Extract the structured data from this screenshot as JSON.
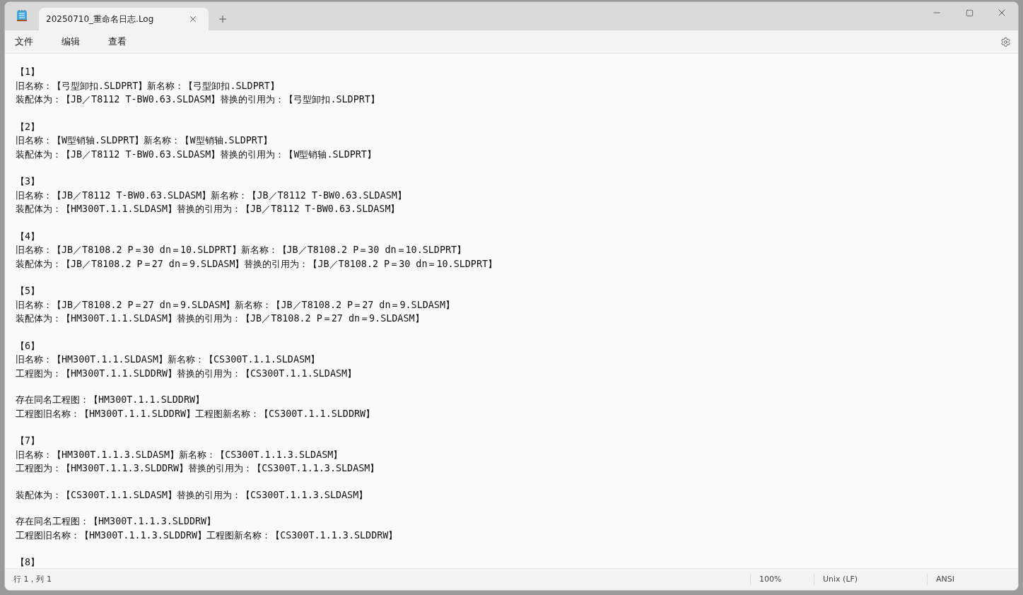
{
  "tab": {
    "title": "20250710_重命名日志.Log",
    "selected": true
  },
  "menu": [
    "文件",
    "编辑",
    "查看"
  ],
  "entries": [
    {
      "label": "【1】",
      "blocks": [
        [
          "旧名称：【弓型卸扣.SLDPRT】新名称：【弓型卸扣.SLDPRT】",
          "装配体为：【JB／T8112 T-BW0.63.SLDASM】替换的引用为：【弓型卸扣.SLDPRT】"
        ]
      ]
    },
    {
      "label": "【2】",
      "blocks": [
        [
          "旧名称：【W型销轴.SLDPRT】新名称：【W型销轴.SLDPRT】",
          "装配体为：【JB／T8112 T-BW0.63.SLDASM】替换的引用为：【W型销轴.SLDPRT】"
        ]
      ]
    },
    {
      "label": "【3】",
      "blocks": [
        [
          "旧名称：【JB／T8112 T-BW0.63.SLDASM】新名称：【JB／T8112 T-BW0.63.SLDASM】",
          "装配体为：【HM300T.1.1.SLDASM】替换的引用为：【JB／T8112 T-BW0.63.SLDASM】"
        ]
      ]
    },
    {
      "label": "【4】",
      "blocks": [
        [
          "旧名称：【JB／T8108.2 P＝30 dn＝10.SLDPRT】新名称：【JB／T8108.2 P＝30 dn＝10.SLDPRT】",
          "装配体为：【JB／T8108.2 P＝27 dn＝9.SLDASM】替换的引用为：【JB／T8108.2 P＝30 dn＝10.SLDPRT】"
        ]
      ]
    },
    {
      "label": "【5】",
      "blocks": [
        [
          "旧名称：【JB／T8108.2 P＝27 dn＝9.SLDASM】新名称：【JB／T8108.2 P＝27 dn＝9.SLDASM】",
          "装配体为：【HM300T.1.1.SLDASM】替换的引用为：【JB／T8108.2 P＝27 dn＝9.SLDASM】"
        ]
      ]
    },
    {
      "label": "【6】",
      "blocks": [
        [
          "旧名称：【HM300T.1.1.SLDASM】新名称：【CS300T.1.1.SLDASM】",
          "工程图为：【HM300T.1.1.SLDDRW】替换的引用为：【CS300T.1.1.SLDASM】"
        ],
        [
          "存在同名工程图：【HM300T.1.1.SLDDRW】",
          "工程图旧名称：【HM300T.1.1.SLDDRW】工程图新名称：【CS300T.1.1.SLDDRW】"
        ]
      ]
    },
    {
      "label": "【7】",
      "blocks": [
        [
          "旧名称：【HM300T.1.1.3.SLDASM】新名称：【CS300T.1.1.3.SLDASM】",
          "工程图为：【HM300T.1.1.3.SLDDRW】替换的引用为：【CS300T.1.1.3.SLDASM】"
        ],
        [
          "装配体为：【CS300T.1.1.SLDASM】替换的引用为：【CS300T.1.1.3.SLDASM】"
        ],
        [
          "存在同名工程图：【HM300T.1.1.3.SLDDRW】",
          "工程图旧名称：【HM300T.1.1.3.SLDDRW】工程图新名称：【CS300T.1.1.3.SLDDRW】"
        ]
      ]
    },
    {
      "label": "【8】"
    }
  ],
  "status_bar": {
    "position": "行 1，列 1",
    "zoom": "100%",
    "line_ending": "Unix (LF)",
    "encoding": "ANSI"
  }
}
